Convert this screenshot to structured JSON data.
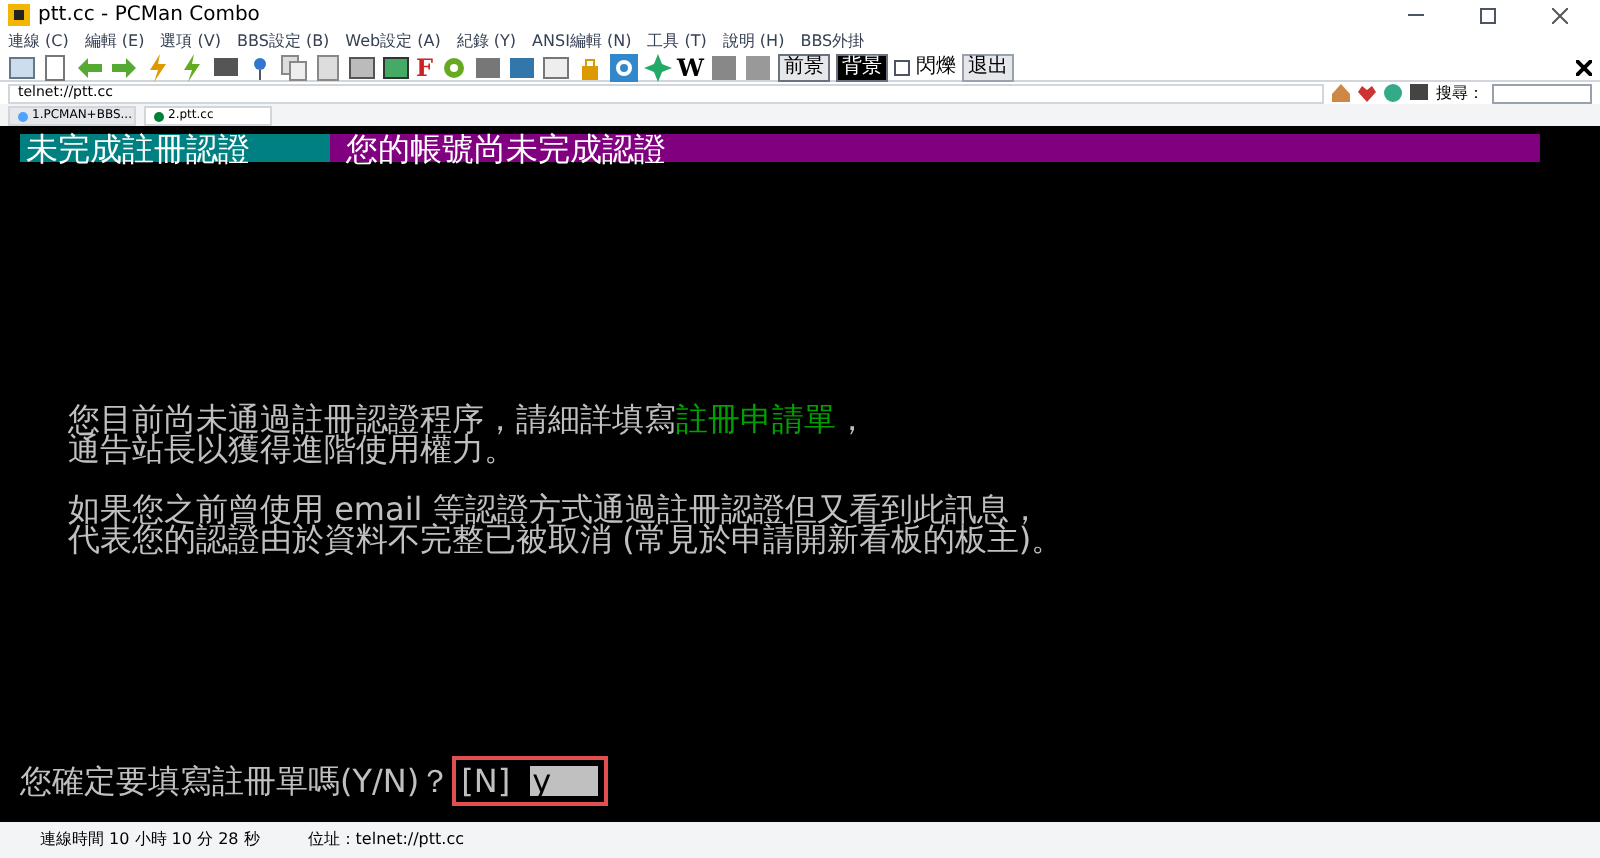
{
  "window": {
    "title": "ptt.cc - PCMan Combo"
  },
  "menu": [
    "連線 (C)",
    "編輯 (E)",
    "選項 (V)",
    "BBS設定 (B)",
    "Web設定 (A)",
    "紀錄 (Y)",
    "ANSI編輯 (N)",
    "工具 (T)",
    "說明 (H)",
    "BBS外掛"
  ],
  "toolbar": {
    "letters": [
      "F",
      "W"
    ],
    "color_buttons": [
      {
        "label": "前景",
        "selected": false
      },
      {
        "label": "背景",
        "selected": true
      }
    ],
    "blink": {
      "label": "閃爍",
      "checked": false
    },
    "exit_button": "退出"
  },
  "address": {
    "value": "telnet://ptt.cc"
  },
  "search": {
    "label": "搜尋："
  },
  "tabs": [
    {
      "label": "1.PCMAN+BBS...",
      "selected": false
    },
    {
      "label": "2.ptt.cc",
      "selected": true
    }
  ],
  "terminal": {
    "header": {
      "title": "未完成註冊認證",
      "message": "您的帳號尚未完成認證"
    },
    "paragraphs": [
      [
        [
          "您目前尚未通過註冊認證程序，請細詳填寫",
          {
            "link": "註冊申請單"
          },
          "，"
        ],
        [
          "通告站長以獲得進階使用權力。"
        ]
      ],
      [
        [
          "如果您之前曾使用 email 等認證方式通過註冊認證但又看到此訊息，"
        ],
        [
          "代表您的認證由於資料不完整已被取消 (常見於申請開新看板的板主)。"
        ]
      ]
    ],
    "prompt": {
      "question": "您確定要填寫註冊單嗎(Y/N)？",
      "default": "[N]",
      "value": "y"
    }
  },
  "status_bar": {
    "connection_time": "連線時間 10 小時 10 分 28 秒",
    "address": "位址：telnet://ptt.cc"
  }
}
